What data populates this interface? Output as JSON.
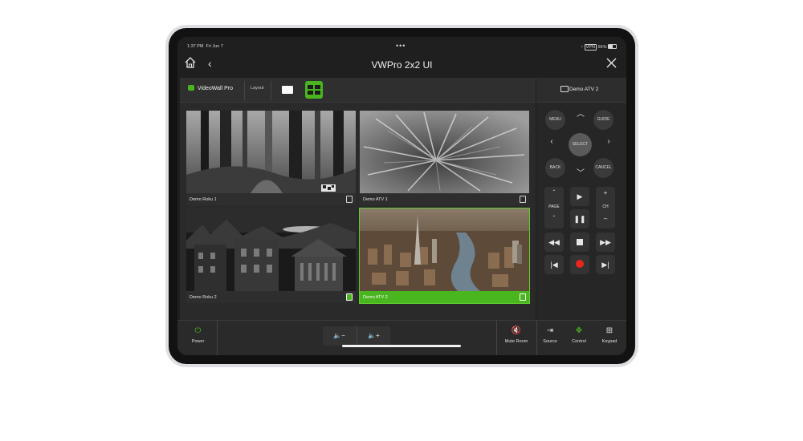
{
  "status_bar": {
    "time": "1:37 PM",
    "date": "Fri Jun 7",
    "battery": "56%"
  },
  "nav": {
    "title": "VWPro 2x2 UI"
  },
  "toolbar": {
    "brand": "VideoWall Pro",
    "layout_label": "Layout"
  },
  "tiles": [
    {
      "label": "Demo Roku 1"
    },
    {
      "label": "Demo ATV 1"
    },
    {
      "label": "Demo Roku 2"
    },
    {
      "label": "Demo ATV 2",
      "active": true
    }
  ],
  "remote": {
    "device": "Demo ATV 2",
    "menu": "MENU",
    "guide": "GUIDE",
    "select": "SELECT",
    "back": "BACK",
    "cancel": "CANCEL",
    "page": "PAGE",
    "ch": "CH"
  },
  "bottom": {
    "power": "Power",
    "mute": "Mute Room",
    "source": "Source",
    "control": "Control",
    "keypad": "Keypad"
  },
  "colors": {
    "accent": "#49b51f",
    "record": "#e8261c"
  }
}
